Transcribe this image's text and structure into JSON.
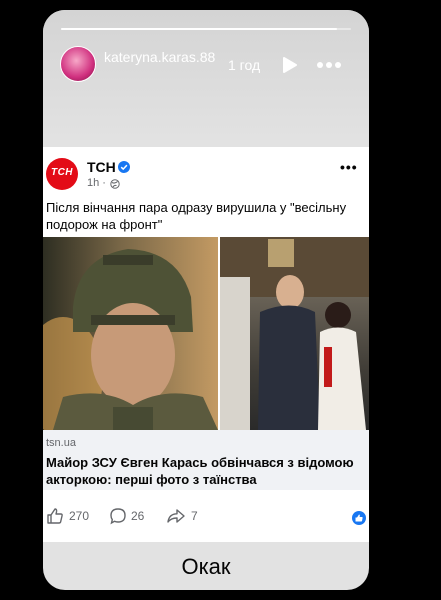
{
  "story": {
    "progress": 0.95,
    "username": "kateryna.karas.88",
    "time_ago": "1 год",
    "play_icon": "play-icon",
    "more_icon": "more-icon",
    "reply_text": "Окак"
  },
  "post": {
    "page_name": "ТСН",
    "avatar_label": "ТСН",
    "time": "1h ·",
    "text": "Після вінчання пара одразу вирушила у \"весільну подорож на фронт\"",
    "link_domain": "tsn.ua",
    "link_title": "Майор ЗСУ Євген Карась обвінчався з відомою акторкою: перші фото з таїнства",
    "reactions": {
      "likes": "270",
      "comments": "26",
      "shares": "7"
    }
  },
  "colors": {
    "brand_red": "#e30b17",
    "facebook_blue": "#1877f2"
  }
}
